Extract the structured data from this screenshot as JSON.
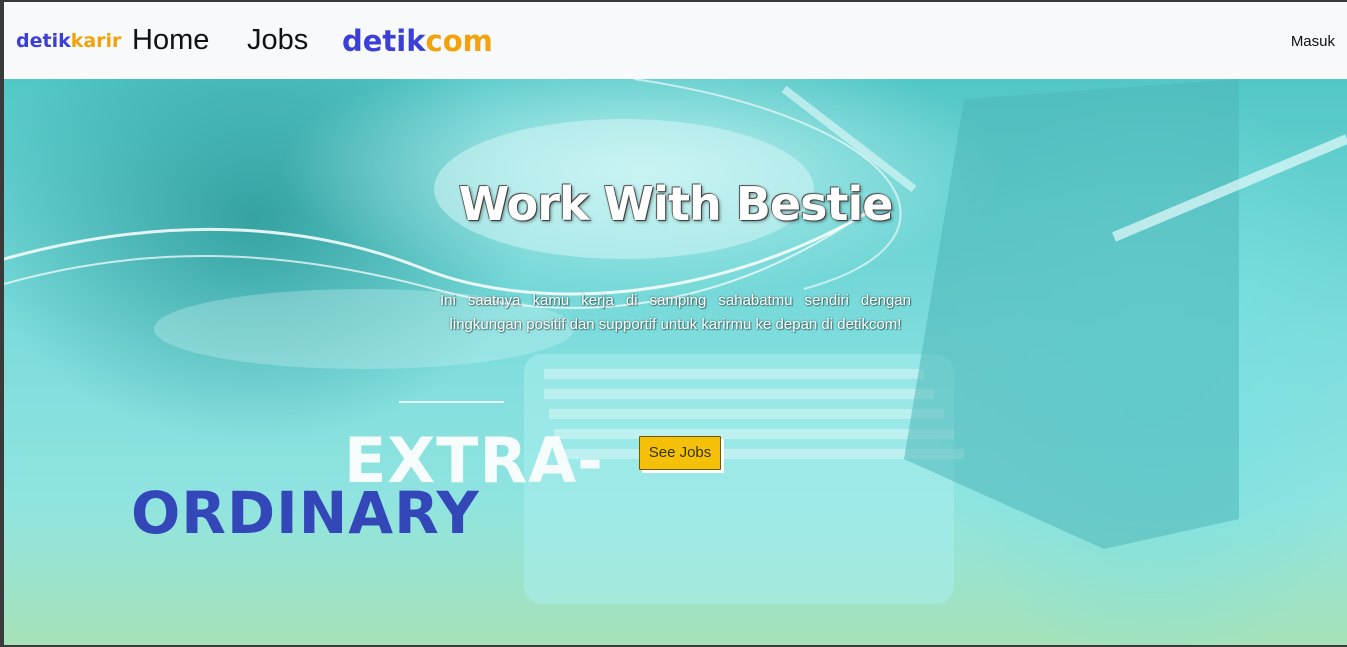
{
  "navbar": {
    "brand_part1": "detik",
    "brand_part2": "karir",
    "home_label": "Home",
    "jobs_label": "Jobs",
    "logo_part1": "detik",
    "logo_part2": "com",
    "login_label": "Masuk"
  },
  "hero": {
    "title": "Work With Bestie",
    "description": "Ini saatnya kamu kerja di samping sahabatmu sendiri dengan lingkungan positif dan supportif untuk karirmu ke depan di detikcom!",
    "button_label": "See Jobs",
    "overlay_text_1": "EXTRA-",
    "overlay_text_2": "ORDINARY"
  },
  "colors": {
    "brand_blue": "#3b3fd8",
    "brand_orange": "#f4a20b",
    "button_yellow": "#f5c009",
    "hero_teal": "#7ddcdc"
  }
}
